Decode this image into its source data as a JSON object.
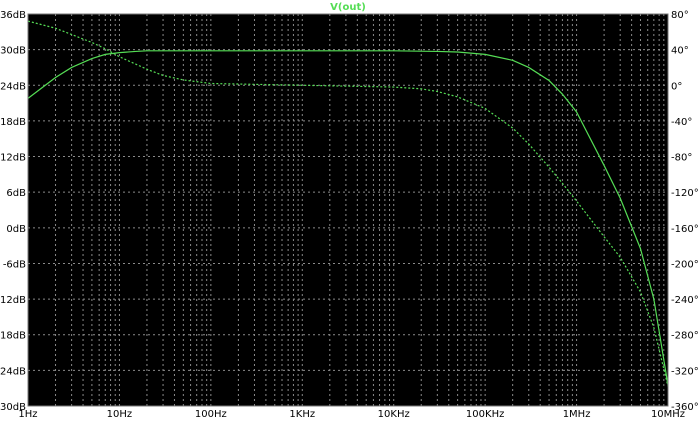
{
  "chart_data": {
    "type": "line",
    "title": "V(out)",
    "x_scale": "log",
    "xlim": [
      1,
      10000000
    ],
    "x_tick_values": [
      1,
      10,
      100,
      1000,
      10000,
      100000,
      1000000,
      10000000
    ],
    "x_tick_labels": [
      "1Hz",
      "10Hz",
      "100Hz",
      "1KHz",
      "10KHz",
      "100KHz",
      "1MHz",
      "10MHz"
    ],
    "y_left": {
      "unit": "dB",
      "lim": [
        -30,
        36
      ],
      "tick_values": [
        36,
        30,
        24,
        18,
        12,
        6,
        0,
        -6,
        -12,
        -18,
        -24,
        -30
      ],
      "tick_labels": [
        "36dB",
        "30dB",
        "24dB",
        "18dB",
        "12dB",
        "6dB",
        "0dB",
        "-6dB",
        "-12dB",
        "-18dB",
        "-24dB",
        "-30dB"
      ]
    },
    "y_right": {
      "unit": "degrees",
      "lim": [
        -360,
        80
      ],
      "tick_values": [
        80,
        40,
        0,
        -40,
        -80,
        -120,
        -160,
        -200,
        -240,
        -280,
        -320,
        -360
      ],
      "tick_labels": [
        "80°",
        "40°",
        "0°",
        "-40°",
        "-80°",
        "-120°",
        "-160°",
        "-200°",
        "-240°",
        "-280°",
        "-320°",
        "-360°"
      ]
    },
    "grid": true,
    "series": [
      {
        "axis": "left",
        "style": "solid",
        "color": "#55dd55",
        "x": [
          1,
          2,
          3,
          5,
          7,
          10,
          15,
          20,
          30,
          100,
          1000,
          10000,
          30000,
          50000,
          100000,
          200000,
          300000,
          500000,
          700000,
          1000000,
          2000000,
          3000000,
          5000000,
          7000000,
          10000000
        ],
        "y": [
          21.8,
          25.3,
          27.0,
          28.5,
          29.2,
          29.5,
          29.7,
          29.8,
          29.8,
          29.8,
          29.8,
          29.8,
          29.7,
          29.6,
          29.2,
          28.2,
          27.0,
          24.8,
          22.5,
          19.5,
          10.5,
          5.0,
          -3.5,
          -12.0,
          -26.5
        ]
      },
      {
        "axis": "right",
        "style": "dashed",
        "color": "#55dd55",
        "x": [
          1,
          2,
          3,
          5,
          7,
          10,
          20,
          30,
          50,
          100,
          1000,
          10000,
          20000,
          30000,
          50000,
          100000,
          200000,
          300000,
          500000,
          700000,
          1000000,
          2000000,
          3000000,
          5000000,
          7000000,
          10000000
        ],
        "y": [
          72,
          64,
          57,
          48,
          41,
          32,
          18,
          11,
          6,
          2,
          0,
          -2,
          -4,
          -7,
          -13,
          -26,
          -48,
          -66,
          -92,
          -110,
          -130,
          -170,
          -193,
          -232,
          -272,
          -338
        ]
      }
    ]
  }
}
